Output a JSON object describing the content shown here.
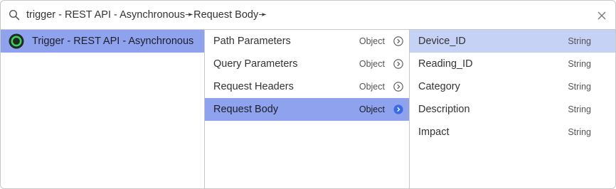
{
  "search": {
    "breadcrumb_text": "trigger - REST API - Asynchronous➛Request Body➛",
    "search_icon": "search-icon",
    "close_icon": "close-icon"
  },
  "column1": {
    "items": [
      {
        "label": "Trigger - REST API - Asynchronous",
        "icon": "trigger-node-icon",
        "selected": true
      }
    ]
  },
  "column2": {
    "items": [
      {
        "label": "Path Parameters",
        "type": "Object",
        "selected": false
      },
      {
        "label": "Query Parameters",
        "type": "Object",
        "selected": false
      },
      {
        "label": "Request Headers",
        "type": "Object",
        "selected": false
      },
      {
        "label": "Request Body",
        "type": "Object",
        "selected": true
      }
    ]
  },
  "column3": {
    "items": [
      {
        "label": "Device_ID",
        "type": "String",
        "highlighted": true
      },
      {
        "label": "Reading_ID",
        "type": "String",
        "highlighted": false
      },
      {
        "label": "Category",
        "type": "String",
        "highlighted": false
      },
      {
        "label": "Description",
        "type": "String",
        "highlighted": false
      },
      {
        "label": "Impact",
        "type": "String",
        "highlighted": false
      }
    ]
  },
  "colors": {
    "selected_bg": "#8ea2ee",
    "highlight_bg": "#c6d1f6",
    "accent_blue": "#3b6ae8",
    "trigger_green": "#3ecf5a",
    "border": "#c8c8c8"
  }
}
